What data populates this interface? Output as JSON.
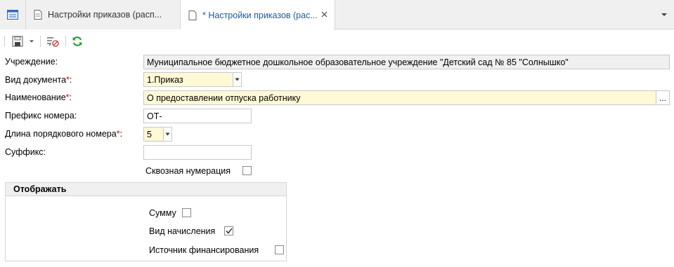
{
  "tabs": {
    "home_icon": "table-icon",
    "items": [
      {
        "label": "Настройки приказов (расп...",
        "icon": "document-icon"
      },
      {
        "label": "* Настройки приказов (рас...",
        "icon": "document-icon"
      }
    ],
    "close_symbol": "✕",
    "overflow_icon": "chevron-down-icon"
  },
  "toolbar": {
    "icons": [
      "save-icon",
      "dropdown-arrow-icon",
      "approve-clear-icon",
      "refresh-icon"
    ]
  },
  "form": {
    "institution_label": "Учреждение:",
    "institution_value": "Муниципальное бюджетное дошкольное образовательное учреждение \"Детский сад № 85 \"Солнышко\"",
    "doc_type_label": "Вид документа",
    "doc_type_value": "1.Приказ",
    "name_label": "Наименование",
    "name_value": "О предоставлении отпуска работнику",
    "prefix_label": "Префикс номера:",
    "prefix_value": "ОТ-",
    "seq_length_label": "Длина порядкового номера",
    "seq_length_value": "5",
    "suffix_label": "Суффикс:",
    "suffix_value": "",
    "through_numbering_label": "Сквозная нумерация",
    "through_numbering_checked": false,
    "required_mark": "*",
    "colon": ":",
    "ellipsis": "..."
  },
  "display_group": {
    "title": "Отображать",
    "options": [
      {
        "label": "Сумму",
        "checked": false
      },
      {
        "label": "Вид начисления",
        "checked": true
      },
      {
        "label": "Источник финансирования",
        "checked": false
      }
    ]
  },
  "colors": {
    "required_bg": "#fff9d6",
    "readonly_bg": "#f0f0f0",
    "accent": "#1e5a9a",
    "refresh_green": "#2e9a3a"
  }
}
